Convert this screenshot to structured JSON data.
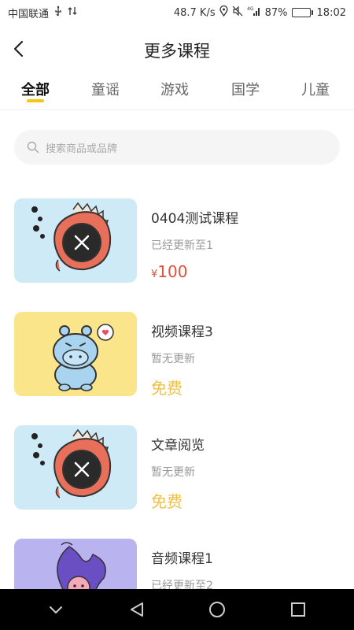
{
  "status": {
    "carrier": "中国联通",
    "speed": "48.7 K/s",
    "network": "4G",
    "battery_percent": "87%",
    "battery_level": 0.87,
    "time": "18:02"
  },
  "header": {
    "title": "更多课程"
  },
  "tabs": [
    {
      "label": "全部",
      "active": true
    },
    {
      "label": "童谣",
      "active": false
    },
    {
      "label": "游戏",
      "active": false
    },
    {
      "label": "国学",
      "active": false
    },
    {
      "label": "儿童",
      "active": false
    }
  ],
  "search": {
    "placeholder": "搜索商品或品牌"
  },
  "courses": [
    {
      "title": "0404测试课程",
      "subtitle": "已经更新至1",
      "price_symbol": "¥",
      "price": "100",
      "price_color": "#e0503c",
      "thumb": "fish-character"
    },
    {
      "title": "视频课程3",
      "subtitle": "暂无更新",
      "price_symbol": "",
      "price": "免费",
      "price_color": "#f0c040",
      "thumb": "hippo-character"
    },
    {
      "title": "文章阅览",
      "subtitle": "暂无更新",
      "price_symbol": "",
      "price": "免费",
      "price_color": "#f0c040",
      "thumb": "fish-character"
    },
    {
      "title": "音频课程1",
      "subtitle": "已经更新至2",
      "price_symbol": "",
      "price": "",
      "price_color": "#f0c040",
      "thumb": "purple-character"
    }
  ],
  "colors": {
    "accent": "#f5c518",
    "price_red": "#e0503c",
    "free_yellow": "#f0c040"
  }
}
